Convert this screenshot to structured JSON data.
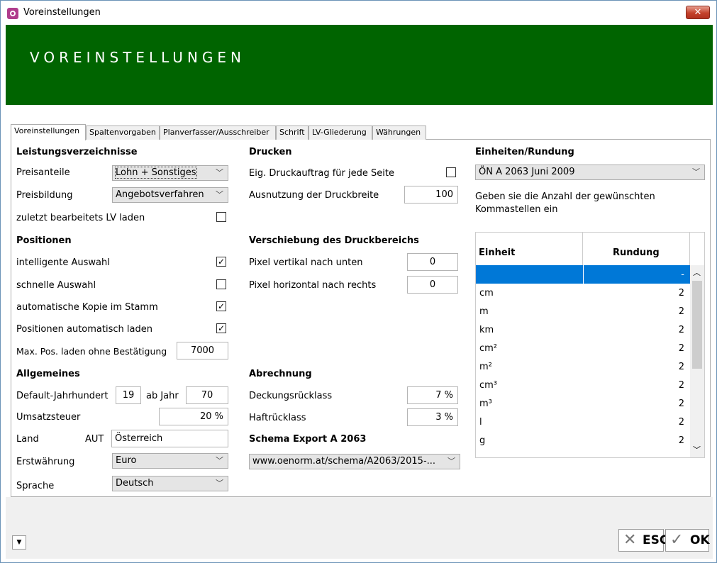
{
  "window": {
    "title": "Voreinstellungen",
    "close_glyph": "✕"
  },
  "banner": {
    "title": "VOREINSTELLUNGEN"
  },
  "tabs": [
    {
      "label": "Voreinstellungen",
      "active": true
    },
    {
      "label": "Spaltenvorgaben",
      "active": false
    },
    {
      "label": "Planverfasser/Ausschreiber",
      "active": false
    },
    {
      "label": "Schrift",
      "active": false
    },
    {
      "label": "LV-Gliederung",
      "active": false
    },
    {
      "label": "Währungen",
      "active": false
    }
  ],
  "lv": {
    "heading": "Leistungsverzeichnisse",
    "preisanteile_label": "Preisanteile",
    "preisanteile_value": "Lohn + Sonstiges",
    "preisbildung_label": "Preisbildung",
    "preisbildung_value": "Angebotsverfahren",
    "zuletzt_label": "zuletzt bearbeitets LV laden",
    "zuletzt_checked": false
  },
  "positionen": {
    "heading": "Positionen",
    "intelligente_label": "intelligente Auswahl",
    "intelligente_checked": true,
    "schnelle_label": "schnelle Auswahl",
    "schnelle_checked": false,
    "kopie_label": "automatische Kopie im Stamm",
    "kopie_checked": true,
    "laden_label": "Positionen automatisch laden",
    "laden_checked": true,
    "maxpos_label": "Max. Pos. laden ohne Bestätigung",
    "maxpos_value": "7000"
  },
  "allgemeines": {
    "heading": "Allgemeines",
    "jahrhundert_label": "Default-Jahrhundert",
    "jahrhundert_value": "19",
    "abjahr_label": "ab Jahr",
    "abjahr_value": "70",
    "ust_label": "Umsatzsteuer",
    "ust_value": "20 %",
    "land_label": "Land",
    "land_code": "AUT",
    "land_value": "Österreich",
    "erstwaehrung_label": "Erstwährung",
    "erstwaehrung_value": "Euro",
    "sprache_label": "Sprache",
    "sprache_value": "Deutsch"
  },
  "drucken": {
    "heading": "Drucken",
    "eig_label": "Eig. Druckauftrag für jede Seite",
    "eig_checked": false,
    "ausnutzung_label": "Ausnutzung der Druckbreite",
    "ausnutzung_value": "100"
  },
  "verschiebung": {
    "heading": "Verschiebung des Druckbereichs",
    "vertikal_label": "Pixel vertikal nach unten",
    "vertikal_value": "0",
    "horizontal_label": "Pixel horizontal nach rechts",
    "horizontal_value": "0"
  },
  "abrechnung": {
    "heading": "Abrechnung",
    "deckung_label": "Deckungsrücklass",
    "deckung_value": "7 %",
    "haft_label": "Haftrücklass",
    "haft_value": "3 %"
  },
  "schema": {
    "heading": "Schema Export A 2063",
    "value": "www.oenorm.at/schema/A2063/2015-..."
  },
  "einheiten": {
    "heading": "Einheiten/Rundung",
    "norm_value": "ÖN A 2063 Juni 2009",
    "hint": "Geben sie die Anzahl der gewünschten Kommastellen ein",
    "col_einheit": "Einheit",
    "col_rundung": "Rundung",
    "rows": [
      {
        "unit": "",
        "value": "-"
      },
      {
        "unit": "cm",
        "value": "2"
      },
      {
        "unit": "m",
        "value": "2"
      },
      {
        "unit": "km",
        "value": "2"
      },
      {
        "unit": "cm²",
        "value": "2"
      },
      {
        "unit": "m²",
        "value": "2"
      },
      {
        "unit": "cm³",
        "value": "2"
      },
      {
        "unit": "m³",
        "value": "2"
      },
      {
        "unit": "l",
        "value": "2"
      },
      {
        "unit": "g",
        "value": "2"
      }
    ]
  },
  "footer": {
    "esc_label": "ESC",
    "ok_label": "OK"
  },
  "colors": {
    "banner": "#006400",
    "selection": "#0078d7"
  }
}
